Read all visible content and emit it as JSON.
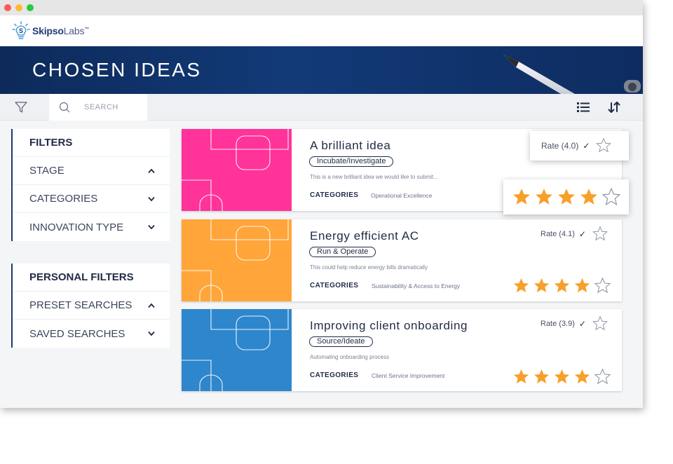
{
  "window": {
    "controls": [
      "close",
      "minimize",
      "maximize"
    ]
  },
  "header": {
    "logo_text_bold": "Skipso",
    "logo_text_light": "Labs",
    "logo_tm": "™"
  },
  "banner": {
    "title": "CHOSEN IDEAS"
  },
  "toolbar": {
    "search_placeholder": "SEARCH",
    "icons": [
      "filter-icon",
      "search-icon",
      "list-view-icon",
      "sort-icon"
    ]
  },
  "filters": {
    "heading": "FILTERS",
    "items": [
      {
        "label": "STAGE",
        "expanded": true
      },
      {
        "label": "CATEGORIES",
        "expanded": false
      },
      {
        "label": "INNOVATION TYPE",
        "expanded": false
      }
    ]
  },
  "personal_filters": {
    "heading": "PERSONAL FILTERS",
    "items": [
      {
        "label": "PRESET SEARCHES",
        "expanded": true
      },
      {
        "label": "SAVED SEARCHES",
        "expanded": false
      }
    ]
  },
  "ideas": [
    {
      "title": "A brilliant idea",
      "stage": "Incubate/Investigate",
      "description": "This is a new brilliant idea we would like to submit...",
      "categories_label": "CATEGORIES",
      "category": "Operational Excellence",
      "rate_label": "Rate (4.0)",
      "rating": 4,
      "max_rating": 5,
      "color": "#ff3399"
    },
    {
      "title": "Energy efficient AC",
      "stage": "Run & Operate",
      "description": "This could help reduce energy bills dramatically",
      "categories_label": "CATEGORIES",
      "category": "Sustainability & Access to Energy",
      "rate_label": "Rate (4.1)",
      "rating": 4,
      "max_rating": 5,
      "color": "#ffa53a"
    },
    {
      "title": "Improving client onboarding",
      "stage": "Source/Ideate",
      "description": "Automating onboarding process",
      "categories_label": "CATEGORIES",
      "category": "Client Service Improvement",
      "rate_label": "Rate (3.9)",
      "rating": 4,
      "max_rating": 5,
      "color": "#2e86cc"
    }
  ],
  "colors": {
    "navy": "#1f2a44",
    "banner": "#123a78",
    "star": "#f7a02a"
  }
}
